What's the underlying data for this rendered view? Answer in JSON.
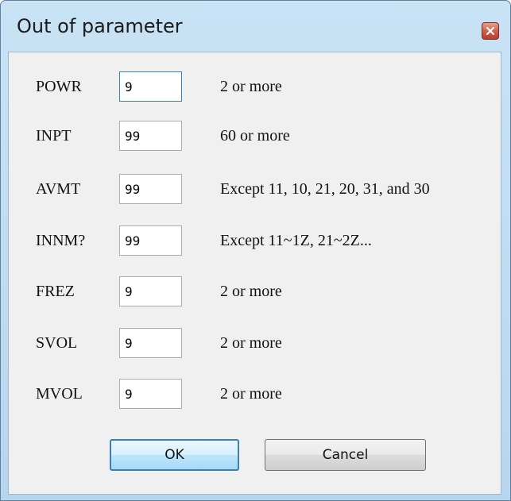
{
  "window": {
    "title": "Out of parameter",
    "close_icon": "close-icon"
  },
  "rows": [
    {
      "label": "POWR",
      "value": "9",
      "description": "2 or more"
    },
    {
      "label": "INPT",
      "value": "99",
      "description": "60 or more"
    },
    {
      "label": "AVMT",
      "value": "99",
      "description": "Except 11, 10, 21, 20, 31, and 30"
    },
    {
      "label": "INNM?",
      "value": "99",
      "description": "Except 11~1Z, 21~2Z..."
    },
    {
      "label": "FREZ",
      "value": "9",
      "description": "2 or more"
    },
    {
      "label": "SVOL",
      "value": "9",
      "description": "2 or more"
    },
    {
      "label": "MVOL",
      "value": "9",
      "description": "2 or more"
    }
  ],
  "buttons": {
    "ok_label": "OK",
    "cancel_label": "Cancel"
  },
  "colors": {
    "title_bar": "#c9e3f5",
    "client_bg": "#f0f0f0",
    "close_button": "#cf5f4c",
    "focus_border": "#3c7fb1"
  }
}
